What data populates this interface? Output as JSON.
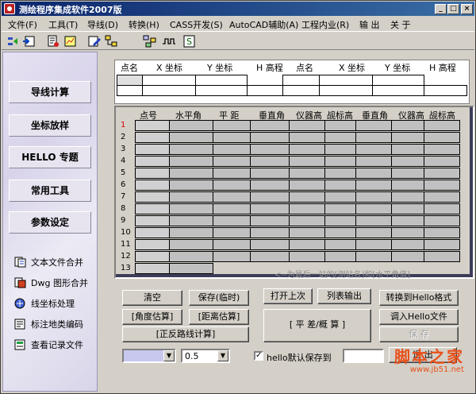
{
  "window": {
    "title": "测绘程序集成软件2007版",
    "controls": {
      "minimize": "_",
      "maximize": "□",
      "close": "×"
    }
  },
  "menu": [
    {
      "label": "文件(F)"
    },
    {
      "label": "工具(T)"
    },
    {
      "label": "导线(D)"
    },
    {
      "label": "转换(H)"
    },
    {
      "label": "CASS开发(S)"
    },
    {
      "label": "AutoCAD辅助(A)"
    },
    {
      "label": "工程内业(R)"
    },
    {
      "label": "输 出"
    },
    {
      "label": "关 于"
    }
  ],
  "toolbar_icons": [
    "arrow-icon",
    "import-icon",
    "document-icon",
    "plot-icon",
    "edit-icon",
    "tree-icon",
    "network-icon",
    "wave-icon",
    "dollar-icon"
  ],
  "nav": [
    {
      "label": "导线计算"
    },
    {
      "label": "坐标放样"
    },
    {
      "label": "HELLO 专题"
    },
    {
      "label": "常用工具"
    },
    {
      "label": "参数设定"
    }
  ],
  "side_links": [
    {
      "label": "文本文件合并",
      "icon": "text-merge-icon"
    },
    {
      "label": "Dwg 图形合并",
      "icon": "dwg-merge-icon"
    },
    {
      "label": "线坐标处理",
      "icon": "line-coordinate-icon"
    },
    {
      "label": "标注地类编码",
      "icon": "land-code-icon"
    },
    {
      "label": "查看记录文件",
      "icon": "record-file-icon"
    }
  ],
  "coord_table": {
    "headers": [
      "点名",
      "X 坐标",
      "Y 坐标",
      "H 高程",
      "点名",
      "X 坐标",
      "Y 坐标",
      "H 高程"
    ]
  },
  "grid": {
    "headers": [
      "点号",
      "水平角",
      "平 距",
      "垂直角",
      "仪器高",
      "觇标高",
      "垂直角",
      "仪器高",
      "觇标高"
    ],
    "rows": [
      "1",
      "2",
      "3",
      "4",
      "5",
      "6",
      "7",
      "8",
      "9",
      "10",
      "11",
      "12",
      "13"
    ],
    "note": "<--为最后一站的[测站名]和[水平角值]",
    "highlight_row_color": "#d40000"
  },
  "buttons": {
    "clear": "清空",
    "save_temp": "保存(临时)",
    "open_last": "打开上次",
    "list_output": "列表输出",
    "to_hello": "转换到Hello格式",
    "angle_estimate": "[角度估算]",
    "distance_estimate": "[距离估算]",
    "closure": "[ 平 差/概 算 ]",
    "load_hello": "调入Hello文件",
    "inverse_calc": "[正反路线计算]",
    "save": "保 存",
    "close": "退 出"
  },
  "controls": {
    "combo1_value": "",
    "combo2_value": "0.5",
    "hello_checkbox_label": "hello默认保存到",
    "hello_checked": true,
    "check_mark": "✓"
  },
  "watermark": {
    "main": "脚本之家",
    "url": "www.jb51.net"
  }
}
